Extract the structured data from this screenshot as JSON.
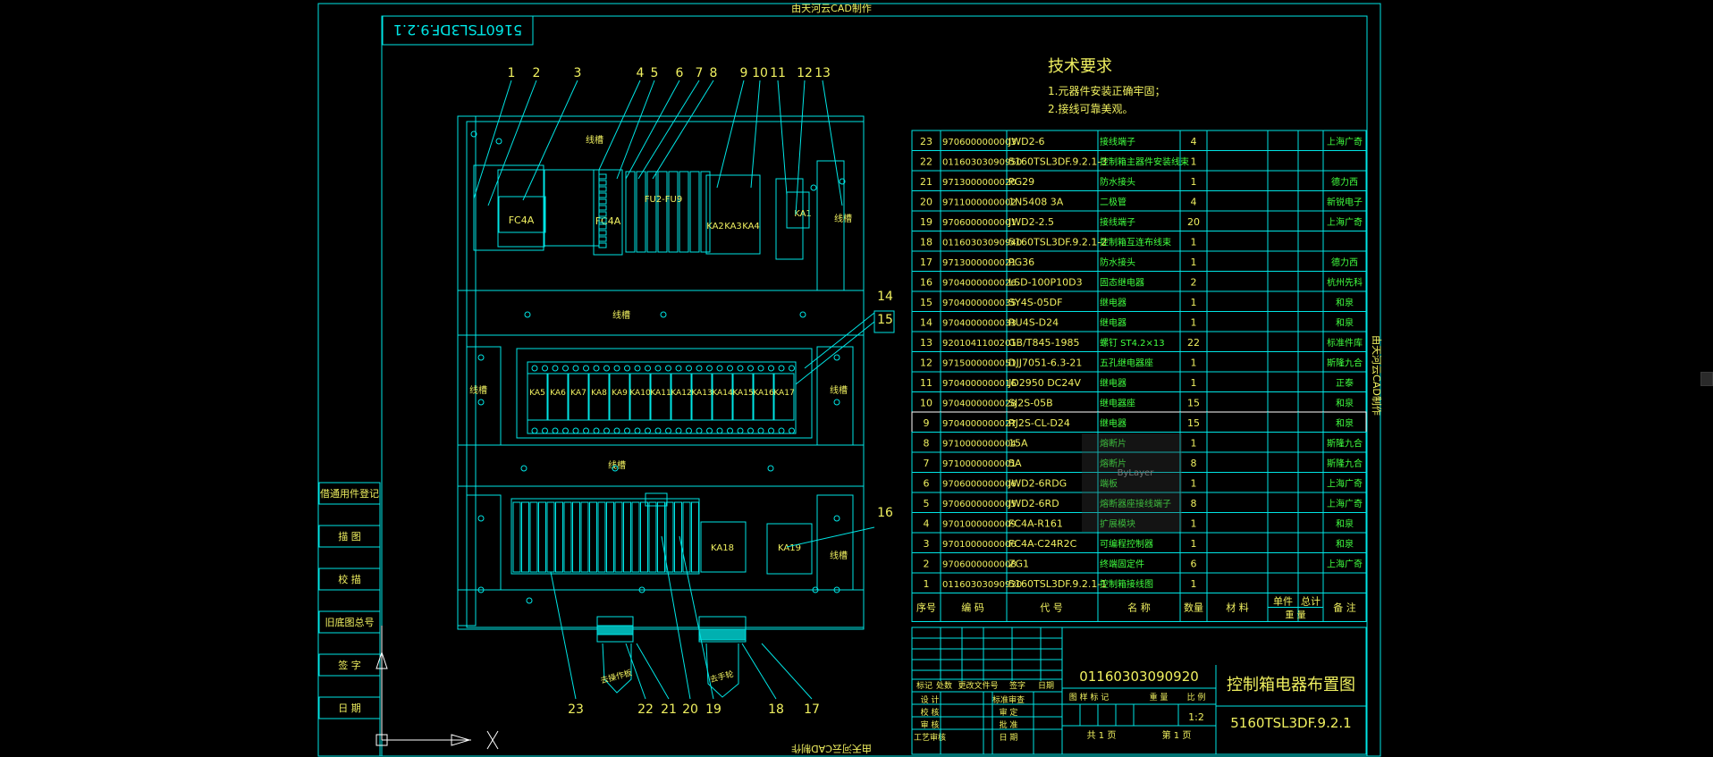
{
  "watermark": "由天河云CAD制作",
  "drawing_code": "5160TSL3DF.9.2.1",
  "tech": {
    "title": "技术要求",
    "line1": "1.元器件安装正确牢固；",
    "line2": "2.接线可靠美观。"
  },
  "panel": {
    "duct": "线槽",
    "labels": {
      "fc4a_1": "FC4A",
      "fc4a_2": "FC4A",
      "fu": "FU2-FU9",
      "ka1": "KA1",
      "ka2": "KA2",
      "ka3": "KA3",
      "ka4": "KA4",
      "ka18": "KA18",
      "ka19": "KA19",
      "relays": [
        "KA5",
        "KA6",
        "KA7",
        "KA8",
        "KA9",
        "KA10",
        "KA11",
        "KA12",
        "KA13",
        "KA14",
        "KA15",
        "KA16",
        "KA17"
      ],
      "gland1": "去操作板",
      "gland2": "去手轮"
    }
  },
  "callouts_top": [
    "1",
    "2",
    "3",
    "4",
    "5",
    "6",
    "7",
    "8",
    "9",
    "10",
    "11",
    "12",
    "13"
  ],
  "callouts_side": [
    "14",
    "15",
    "16"
  ],
  "callouts_bottom": [
    "23",
    "22",
    "21",
    "20",
    "19",
    "18",
    "17"
  ],
  "left_stamp": [
    "借通用件登记",
    "描 图",
    "校 描",
    "旧底图总号",
    "签 字",
    "日 期"
  ],
  "bom": {
    "rows": [
      [
        "23",
        "9706000000003",
        "JWD2-6",
        "接线端子",
        "4",
        "",
        "",
        "",
        "上海广奇"
      ],
      [
        "22",
        "01160303090950",
        "5160TSL3DF.9.2.1-3",
        "控制箱主器件安装线束",
        "1",
        "",
        "",
        "",
        ""
      ],
      [
        "21",
        "9713000000020",
        "PG29",
        "防水接头",
        "1",
        "",
        "",
        "",
        "德力西"
      ],
      [
        "20",
        "9711000000002",
        "1N5408 3A",
        "二极管",
        "4",
        "",
        "",
        "",
        "新锐电子"
      ],
      [
        "19",
        "9706000000001",
        "JWD2-2.5",
        "接线端子",
        "20",
        "",
        "",
        "",
        "上海广奇"
      ],
      [
        "18",
        "01160303090940",
        "5160TSL3DF.9.2.1-2",
        "控制箱互连布线束",
        "1",
        "",
        "",
        "",
        ""
      ],
      [
        "17",
        "9713000000021",
        "PG36",
        "防水接头",
        "1",
        "",
        "",
        "",
        "德力西"
      ],
      [
        "16",
        "9704000000026",
        "LSD-100P10D3",
        "固态继电器",
        "2",
        "",
        "",
        "",
        "杭州先科"
      ],
      [
        "15",
        "9704000000035",
        "SY4S-05DF",
        "继电器",
        "1",
        "",
        "",
        "",
        "和泉"
      ],
      [
        "14",
        "9704000000033",
        "RU4S-D24",
        "继电器",
        "1",
        "",
        "",
        "",
        "和泉"
      ],
      [
        "13",
        "9201041100201",
        "GB/T845-1985",
        "螺钉 ST4.2×13",
        "22",
        "",
        "",
        "",
        "标准件库"
      ],
      [
        "12",
        "9715000000051",
        "DJJ7051-6.3-21",
        "五孔继电器座",
        "1",
        "",
        "",
        "",
        "斯隆九合"
      ],
      [
        "11",
        "9704000000016",
        "JD2950 DC24V",
        "继电器",
        "1",
        "",
        "",
        "",
        "正泰"
      ],
      [
        "10",
        "9704000000028",
        "SJ2S-05B",
        "继电器座",
        "15",
        "",
        "",
        "",
        "和泉"
      ],
      [
        "9",
        "9704000000027",
        "RJ2S-CL-D24",
        "继电器",
        "15",
        "",
        "",
        "",
        "和泉"
      ],
      [
        "8",
        "9710000000004",
        "15A",
        "熔断片",
        "1",
        "",
        "",
        "",
        "斯隆九合"
      ],
      [
        "7",
        "9710000000001",
        "5A",
        "熔断片",
        "8",
        "",
        "",
        "",
        "斯隆九合"
      ],
      [
        "6",
        "9706000000006",
        "JWD2-6RDG",
        "端板",
        "1",
        "",
        "",
        "",
        "上海广奇"
      ],
      [
        "5",
        "9706000000005",
        "JWD2-6RD",
        "熔断器座接线端子",
        "8",
        "",
        "",
        "",
        "上海广奇"
      ],
      [
        "4",
        "9701000000009",
        "FC4A-R161",
        "扩展模块",
        "1",
        "",
        "",
        "",
        "和泉"
      ],
      [
        "3",
        "9701000000006",
        "FC4A-C24R2C",
        "可编程控制器",
        "1",
        "",
        "",
        "",
        "和泉"
      ],
      [
        "2",
        "9706000000008",
        "ZG1",
        "终端固定件",
        "6",
        "",
        "",
        "",
        "上海广奇"
      ],
      [
        "1",
        "01160303090930",
        "5160TSL3DF.9.2.1-1",
        "控制箱接线图",
        "1",
        "",
        "",
        "",
        ""
      ]
    ],
    "header": [
      "序号",
      "编 码",
      "代 号",
      "名 称",
      "数量",
      "材 料",
      "单件",
      "总计",
      "备 注"
    ],
    "header_weight": "重 量"
  },
  "title_block": {
    "part_no": "01160303090920",
    "title": "控制箱电器布置图",
    "drawing": "5160TSL3DF.9.2.1",
    "scale": "1:2",
    "scale_label": "比 例",
    "weight_label": "重 量",
    "stage_label": "图 样 标 记",
    "sheets": "共 1 页",
    "sheet": "第 1 页",
    "sign_rows": [
      "设 计",
      "校 核",
      "审 核",
      "工艺审核"
    ],
    "sign_cols": [
      "标记",
      "处数",
      "更改文件号",
      "签字",
      "日期"
    ],
    "std_rows": [
      "标准审查",
      "审 定",
      "批 准",
      "日 期"
    ]
  },
  "tooltip": "ByLayer",
  "colors": {
    "line": "#00e5e5",
    "text": "#f0f060",
    "green": "#40ff40",
    "highlight": "#ffffff"
  }
}
